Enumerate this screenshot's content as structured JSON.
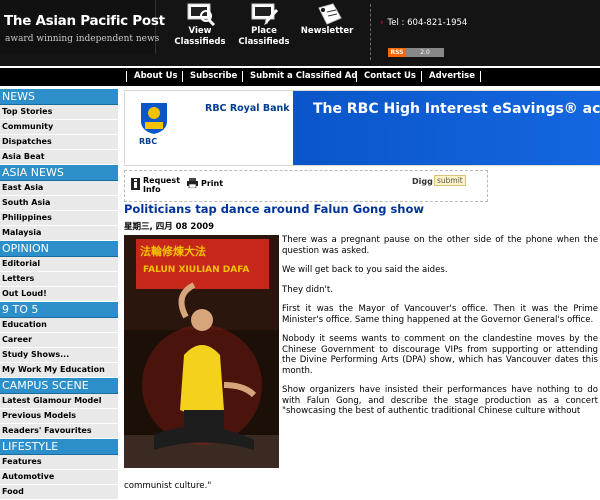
{
  "header": {
    "title": "The Asian Pacific Post",
    "tagline": "award winning independent news",
    "nav": [
      {
        "label1": "View",
        "label2": "Classifieds",
        "icon": "magnifier-monitor-icon"
      },
      {
        "label1": "Place",
        "label2": "Classifieds",
        "icon": "monitor-pencil-icon"
      },
      {
        "label1": "Newsletter",
        "label2": "",
        "icon": "tag-icon"
      }
    ],
    "phone": "Tel : 604-821-1954",
    "rss": {
      "label": "RSS",
      "version": "2.0"
    }
  },
  "topbar": {
    "links": [
      "About Us",
      "Subscribe",
      "Submit a Classified Ad",
      "Contact Us",
      "Advertise"
    ]
  },
  "sidebar": {
    "sections": [
      {
        "title": "NEWS",
        "items": [
          "Top Stories",
          "Community",
          "Dispatches",
          "Asia Beat"
        ]
      },
      {
        "title": "ASIA NEWS",
        "items": [
          "East Asia",
          "South Asia",
          "Philippines",
          "Malaysia"
        ]
      },
      {
        "title": "OPINION",
        "items": [
          "Editorial",
          "Letters",
          "Out Loud!"
        ]
      },
      {
        "title": "9 TO 5",
        "items": [
          "Education",
          "Career",
          "Study Shows...",
          "My Work My Education"
        ]
      },
      {
        "title": "CAMPUS SCENE",
        "items": [
          "Latest Glamour Model",
          "Previous Models",
          "Readers' Favourites"
        ]
      },
      {
        "title": "LIFESTYLE",
        "items": [
          "Features",
          "Automotive",
          "Food"
        ]
      }
    ]
  },
  "banner": {
    "brand": "RBC",
    "bank_name": "RBC Royal Bank",
    "headline": "The RBC High Interest eSavings® accou",
    "colors": {
      "blue": "#0a55c9",
      "gold": "#f2c200"
    }
  },
  "tools": {
    "request_info": "Request Info",
    "print": "Print",
    "digg": "Digg",
    "submit": "submit"
  },
  "article": {
    "headline": "Politicians tap dance around Falun Gong show",
    "date": "星期三, 四月  08 2009",
    "photo_banner_chinese": "法輪修煉大法",
    "photo_banner_english": "FALUN XIULIAN DAFA",
    "paragraphs": [
      "There was a pregnant pause on the other side of the phone when the question was asked.",
      "We will get back to you said the aides.",
      "They didn't.",
      "First it was the Mayor of Vancouver's office. Then it was the Prime Minister's office. Same thing happened at the Governor General's office.",
      "Nobody it seems wants to comment on the clandestine moves by the Chinese Government to discourage VIPs from supporting or attending the Divine Performing Arts (DPA) show, which has Vancouver dates this month.",
      "Show organizers have insisted their performances have nothing to do with Falun Gong, and describe the stage production as a concert \"showcasing the best of authentic traditional Chinese culture without"
    ],
    "last_line": "communist culture.\""
  }
}
